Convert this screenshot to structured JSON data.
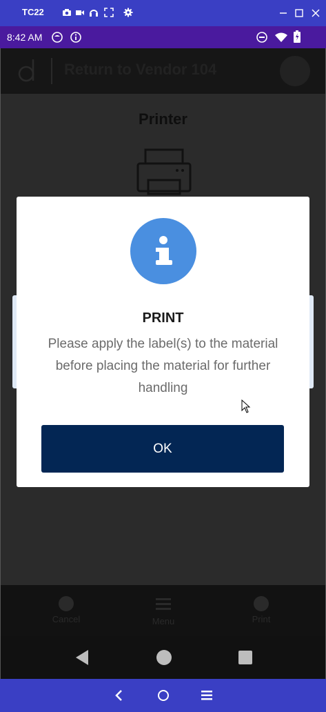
{
  "emulator": {
    "title": "TC22",
    "icons": [
      "camera-icon",
      "video-icon",
      "headphones-icon",
      "fullscreen-icon",
      "settings-icon"
    ],
    "window_controls": [
      "minimize-icon",
      "maximize-icon",
      "close-icon"
    ],
    "nav": [
      "back-chevron-icon",
      "home-circle-icon",
      "menu-icon"
    ]
  },
  "status_bar": {
    "time": "8:42 AM",
    "icons": [
      "profile-icon",
      "info-icon",
      "dnd-icon",
      "wifi-icon",
      "battery-icon"
    ]
  },
  "app": {
    "title": "Return to Vendor 104",
    "printer_heading": "Printer",
    "bottom_nav": [
      {
        "label": "Cancel",
        "icon": "back-circle-icon"
      },
      {
        "label": "Menu",
        "icon": "menu-icon"
      },
      {
        "label": "Print",
        "icon": "forward-circle-icon"
      }
    ]
  },
  "dialog": {
    "icon": "info-icon",
    "title": "PRINT",
    "message": "Please apply the label(s) to the material before placing the material for further handling",
    "ok_label": "OK"
  },
  "colors": {
    "emulator_bar": "#3a3fc4",
    "status_bar": "#4a1a9e",
    "info_icon": "#4a8fe0",
    "ok_button": "#032654"
  }
}
